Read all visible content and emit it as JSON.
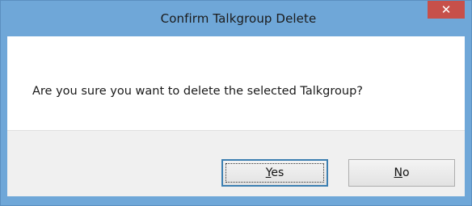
{
  "dialog": {
    "title": "Confirm Talkgroup Delete",
    "close_icon": "close-icon",
    "message": "Are you sure you want to delete the selected Talkgroup?"
  },
  "buttons": {
    "yes": {
      "mnemonic": "Y",
      "rest": "es",
      "label": "Yes"
    },
    "no": {
      "mnemonic": "N",
      "rest": "o",
      "label": "No"
    }
  },
  "colors": {
    "titlebar": "#6fa7d8",
    "close_button": "#c7504a",
    "button_bar": "#f0f0f0",
    "default_button_border": "#3c7fb1"
  }
}
